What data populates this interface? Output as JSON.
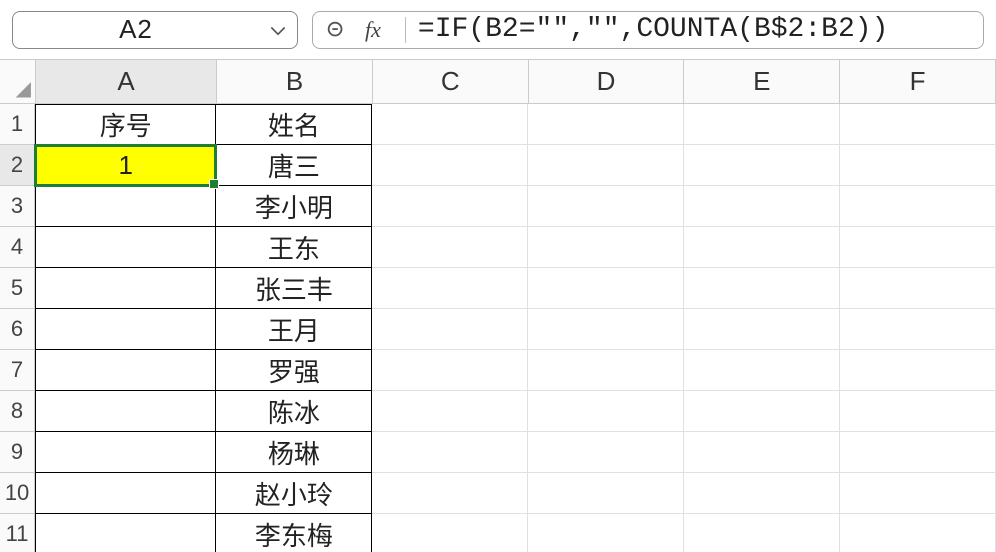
{
  "nameBox": {
    "value": "A2"
  },
  "formulaBar": {
    "fxLabel": "fx",
    "formula": "=IF(B2=\"\",\"\",COUNTA(B$2:B2))"
  },
  "cornerCell": "◢",
  "columns": [
    "A",
    "B",
    "C",
    "D",
    "E",
    "F"
  ],
  "rows": [
    {
      "num": "1",
      "A": "序号",
      "B": "姓名"
    },
    {
      "num": "2",
      "A": "1",
      "B": "唐三"
    },
    {
      "num": "3",
      "A": "",
      "B": "李小明"
    },
    {
      "num": "4",
      "A": "",
      "B": "王东"
    },
    {
      "num": "5",
      "A": "",
      "B": "张三丰"
    },
    {
      "num": "6",
      "A": "",
      "B": "王月"
    },
    {
      "num": "7",
      "A": "",
      "B": "罗强"
    },
    {
      "num": "8",
      "A": "",
      "B": "陈冰"
    },
    {
      "num": "9",
      "A": "",
      "B": "杨琳"
    },
    {
      "num": "10",
      "A": "",
      "B": "赵小玲"
    },
    {
      "num": "11",
      "A": "",
      "B": "李东梅"
    }
  ],
  "activeCell": {
    "row": 2,
    "col": "A"
  },
  "dataRange": {
    "rows": [
      1,
      11
    ],
    "cols": [
      "A",
      "B"
    ]
  }
}
